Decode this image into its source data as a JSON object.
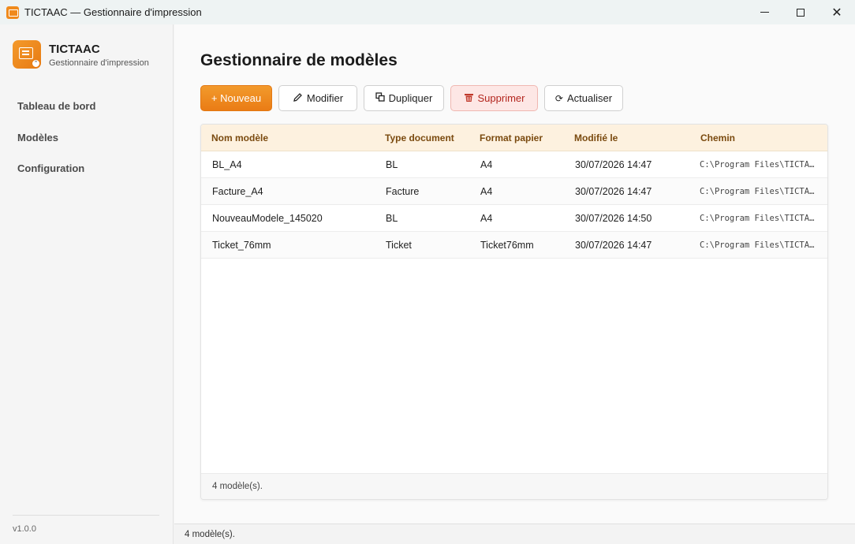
{
  "window": {
    "title": "TICTAAC — Gestionnaire d'impression",
    "minimize_icon": "minimize-icon",
    "maximize_icon": "maximize-icon",
    "close_glyph": "✕"
  },
  "sidebar": {
    "brand_name": "TICTAAC",
    "brand_subtitle": "Gestionnaire d'impression",
    "items": [
      {
        "label": "Tableau de bord"
      },
      {
        "label": "Modèles"
      },
      {
        "label": "Configuration"
      }
    ],
    "version": "v1.0.0"
  },
  "main": {
    "title": "Gestionnaire de modèles",
    "toolbar": {
      "new_label": "+ Nouveau",
      "edit_label": "Modifier",
      "duplicate_label": "Dupliquer",
      "delete_label": "Supprimer",
      "refresh_label": "Actualiser"
    },
    "table": {
      "columns": [
        "Nom modèle",
        "Type document",
        "Format papier",
        "Modifié le",
        "Chemin"
      ],
      "rows": [
        [
          "BL_A4",
          "BL",
          "A4",
          "30/07/2026 14:47",
          "C:\\Program Files\\TICTA…"
        ],
        [
          "Facture_A4",
          "Facture",
          "A4",
          "30/07/2026 14:47",
          "C:\\Program Files\\TICTA…"
        ],
        [
          "NouveauModele_145020",
          "BL",
          "A4",
          "30/07/2026 14:50",
          "C:\\Program Files\\TICTA…"
        ],
        [
          "Ticket_76mm",
          "Ticket",
          "Ticket76mm",
          "30/07/2026 14:47",
          "C:\\Program Files\\TICTA…"
        ]
      ],
      "footer": "4 modèle(s)."
    }
  },
  "statusbar": {
    "text": "4 modèle(s)."
  },
  "colors": {
    "accent": "#ea7c15",
    "danger": "#b3261e",
    "header_bg": "#fdf1df",
    "header_text": "#7a4a0f"
  }
}
